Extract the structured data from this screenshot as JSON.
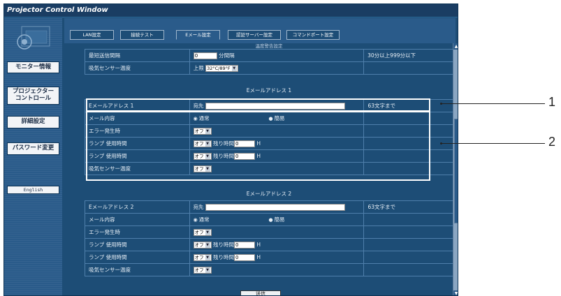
{
  "window": {
    "title": "Projector Control Window"
  },
  "sidebar": {
    "monitor_info": "モニター情報",
    "projector_control": "プロジェクター\nコントロール",
    "detailed_settings": "詳細設定",
    "password_change": "パスワード変更",
    "english": "English"
  },
  "tabs": [
    "LAN設定",
    "接続テスト",
    "Eメール設定",
    "認証サーバー設定",
    "コマンドポート設定"
  ],
  "top_section": {
    "header_partial": "温度警告設定",
    "rows": [
      {
        "label": "最短送信間隔",
        "value": "0",
        "unit": "分間隔",
        "note": "30分以上999分以下"
      },
      {
        "label": "吸気センサー温度",
        "prefix": "上限",
        "select": "32°C/89°F",
        "note": ""
      }
    ]
  },
  "email1": {
    "title": "Eメールアドレス 1",
    "address_label": "Eメールアドレス 1",
    "address_prefix": "宛先",
    "address_value": "",
    "address_note": "63文字まで",
    "content_label": "メール内容",
    "content_opt1": "通常",
    "content_opt2": "簡易",
    "error_label": "エラー発生時",
    "error_value": "オフ",
    "lamp1_label": "ランプ 使用時間",
    "lamp1_value": "オフ",
    "lamp1_remain": "残り時間",
    "lamp1_hours": "0",
    "lamp1_unit": "H",
    "lamp2_label": "ランプ 使用時間",
    "lamp2_value": "オフ",
    "lamp2_remain": "残り時間",
    "lamp2_hours": "0",
    "lamp2_unit": "H",
    "temp_label": "吸気センサー温度",
    "temp_value": "オフ"
  },
  "email2": {
    "title": "Eメールアドレス 2",
    "address_label": "Eメールアドレス 2",
    "address_prefix": "宛先",
    "address_value": "",
    "address_note": "63文字まで",
    "content_label": "メール内容",
    "content_opt1": "通常",
    "content_opt2": "簡易",
    "error_label": "エラー発生時",
    "error_value": "オフ",
    "lamp1_label": "ランプ 使用時間",
    "lamp1_value": "オフ",
    "lamp1_remain": "残り時間",
    "lamp1_hours": "0",
    "lamp1_unit": "H",
    "lamp2_label": "ランプ 使用時間",
    "lamp2_value": "オフ",
    "lamp2_remain": "残り時間",
    "lamp2_hours": "0",
    "lamp2_unit": "H",
    "temp_label": "吸気センサー温度",
    "temp_value": "オフ"
  },
  "submit_label": "送信",
  "callouts": {
    "one": "1",
    "two": "2"
  },
  "colors": {
    "bg": "#1d4d76",
    "sidebar": "#2a5b8a",
    "titlebar": "#1a3d63"
  }
}
